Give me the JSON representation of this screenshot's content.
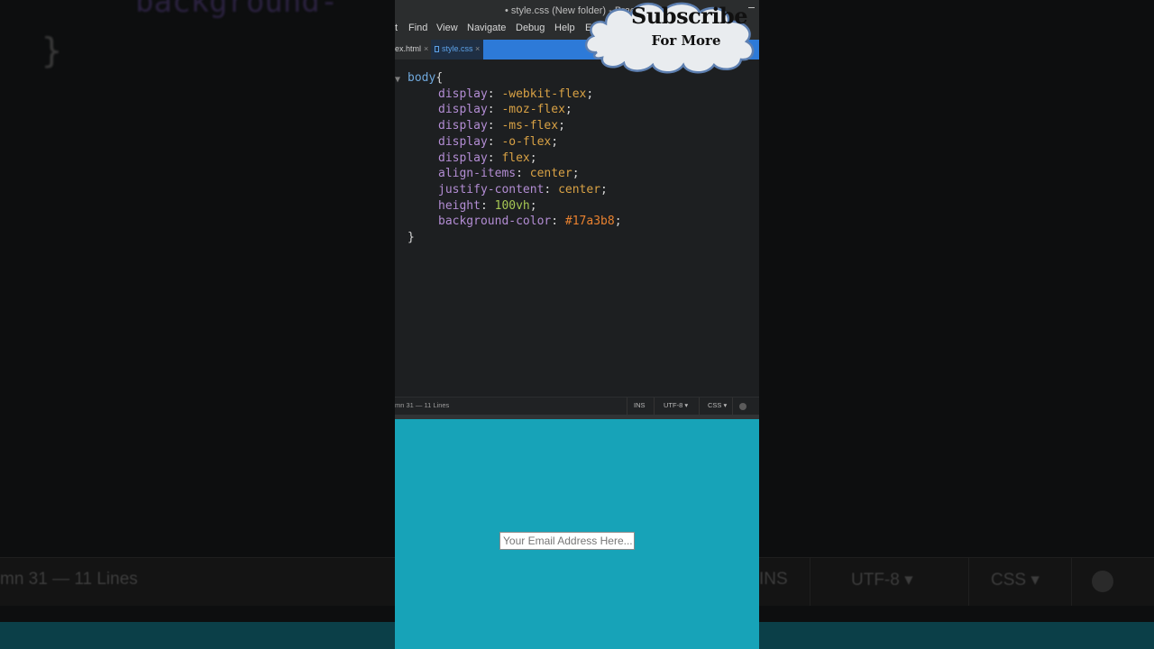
{
  "background": {
    "code_top": "background-",
    "brace": "}",
    "status_left": "mn 31 — 11 Lines",
    "status_ins": "INS",
    "status_encoding": "UTF-8 ▾",
    "status_lang": "CSS ▾"
  },
  "window": {
    "title": "• style.css (New folder) - Brack"
  },
  "menu": [
    "t",
    "Find",
    "View",
    "Navigate",
    "Debug",
    "Help",
    "Emmet"
  ],
  "tabs": [
    {
      "label": "ex.html",
      "close": "×"
    },
    {
      "label": "style.css",
      "close": "×"
    }
  ],
  "code": {
    "fold_marker": "▼",
    "selector": "body",
    "open_brace": "{",
    "close_brace": "}",
    "lines": [
      {
        "prop": "display",
        "value": "-webkit-flex",
        "kind": "val"
      },
      {
        "prop": "display",
        "value": "-moz-flex",
        "kind": "val"
      },
      {
        "prop": "display",
        "value": "-ms-flex",
        "kind": "val"
      },
      {
        "prop": "display",
        "value": "-o-flex",
        "kind": "val"
      },
      {
        "prop": "display",
        "value": "flex",
        "kind": "val"
      },
      {
        "prop": "align-items",
        "value": "center",
        "kind": "val"
      },
      {
        "prop": "justify-content",
        "value": "center",
        "kind": "val"
      },
      {
        "prop": "height",
        "value": "100vh",
        "kind": "num"
      },
      {
        "prop": "background-color",
        "value": "#17a3b8",
        "kind": "hex"
      }
    ]
  },
  "statusbar": {
    "position": "mn 31 — 11 Lines",
    "ins": "INS",
    "encoding": "UTF-8 ▾",
    "language": "CSS ▾"
  },
  "preview": {
    "background_color": "#17a3b8",
    "email_placeholder": "Your Email Address Here..."
  },
  "overlay": {
    "title": "Subscribe",
    "subtitle": "For More"
  },
  "colors": {
    "editor_bg": "#1d1f21",
    "accent_blue": "#2d7ad8",
    "selector": "#6fa8dc",
    "property": "#b38dd4",
    "value": "#d9a245",
    "number": "#a6c754",
    "hex": "#e8812f"
  }
}
